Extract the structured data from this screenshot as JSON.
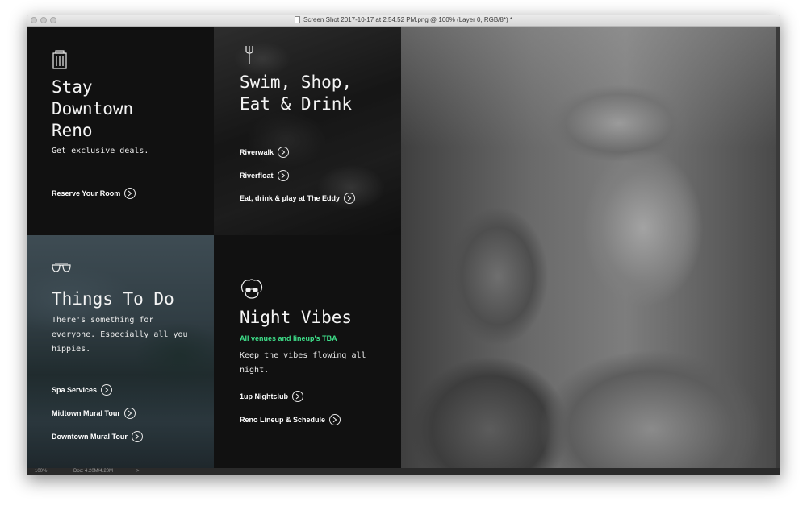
{
  "window": {
    "title": "Screen Shot 2017-10-17 at 2.54.52 PM.png @ 100% (Layer 0, RGB/8*) *"
  },
  "status": {
    "zoom": "100%",
    "doc": "Doc: 4.20M/4.20M",
    "arrow": ">"
  },
  "panels": {
    "stay": {
      "icon": "building-icon",
      "heading_lines": [
        "Stay",
        "Downtown",
        "Reno"
      ],
      "body": "Get exclusive deals.",
      "links": [
        {
          "label": "Reserve Your Room",
          "icon": "arrow-circle-icon"
        }
      ]
    },
    "swim": {
      "icon": "fork-icon",
      "heading_lines": [
        "Swim, Shop,",
        "Eat & Drink"
      ],
      "links": [
        {
          "label": "Riverwalk",
          "icon": "arrow-circle-icon"
        },
        {
          "label": "Riverfloat",
          "icon": "arrow-circle-icon"
        },
        {
          "label": "Eat, drink & play at The Eddy",
          "icon": "arrow-circle-icon"
        }
      ]
    },
    "things": {
      "icon": "sunglasses-icon",
      "heading_lines": [
        "Things To Do"
      ],
      "body_lines": [
        "There's something for",
        "everyone. Especially all you",
        "hippies."
      ],
      "links": [
        {
          "label": "Spa Services",
          "icon": "arrow-circle-icon"
        },
        {
          "label": "Midtown Mural Tour",
          "icon": "arrow-circle-icon"
        },
        {
          "label": "Downtown Mural Tour",
          "icon": "arrow-circle-icon"
        }
      ]
    },
    "night": {
      "icon": "afro-glasses-icon",
      "heading_lines": [
        "Night Vibes"
      ],
      "accent": "All venues and lineup's TBA",
      "body_lines": [
        "Keep the vibes flowing all",
        "night."
      ],
      "links": [
        {
          "label": "1up Nightclub",
          "icon": "arrow-circle-icon"
        },
        {
          "label": "Reno Lineup & Schedule",
          "icon": "arrow-circle-icon"
        }
      ]
    }
  },
  "colors": {
    "accent_green": "#3ee08a",
    "panel_dark": "#111111"
  }
}
